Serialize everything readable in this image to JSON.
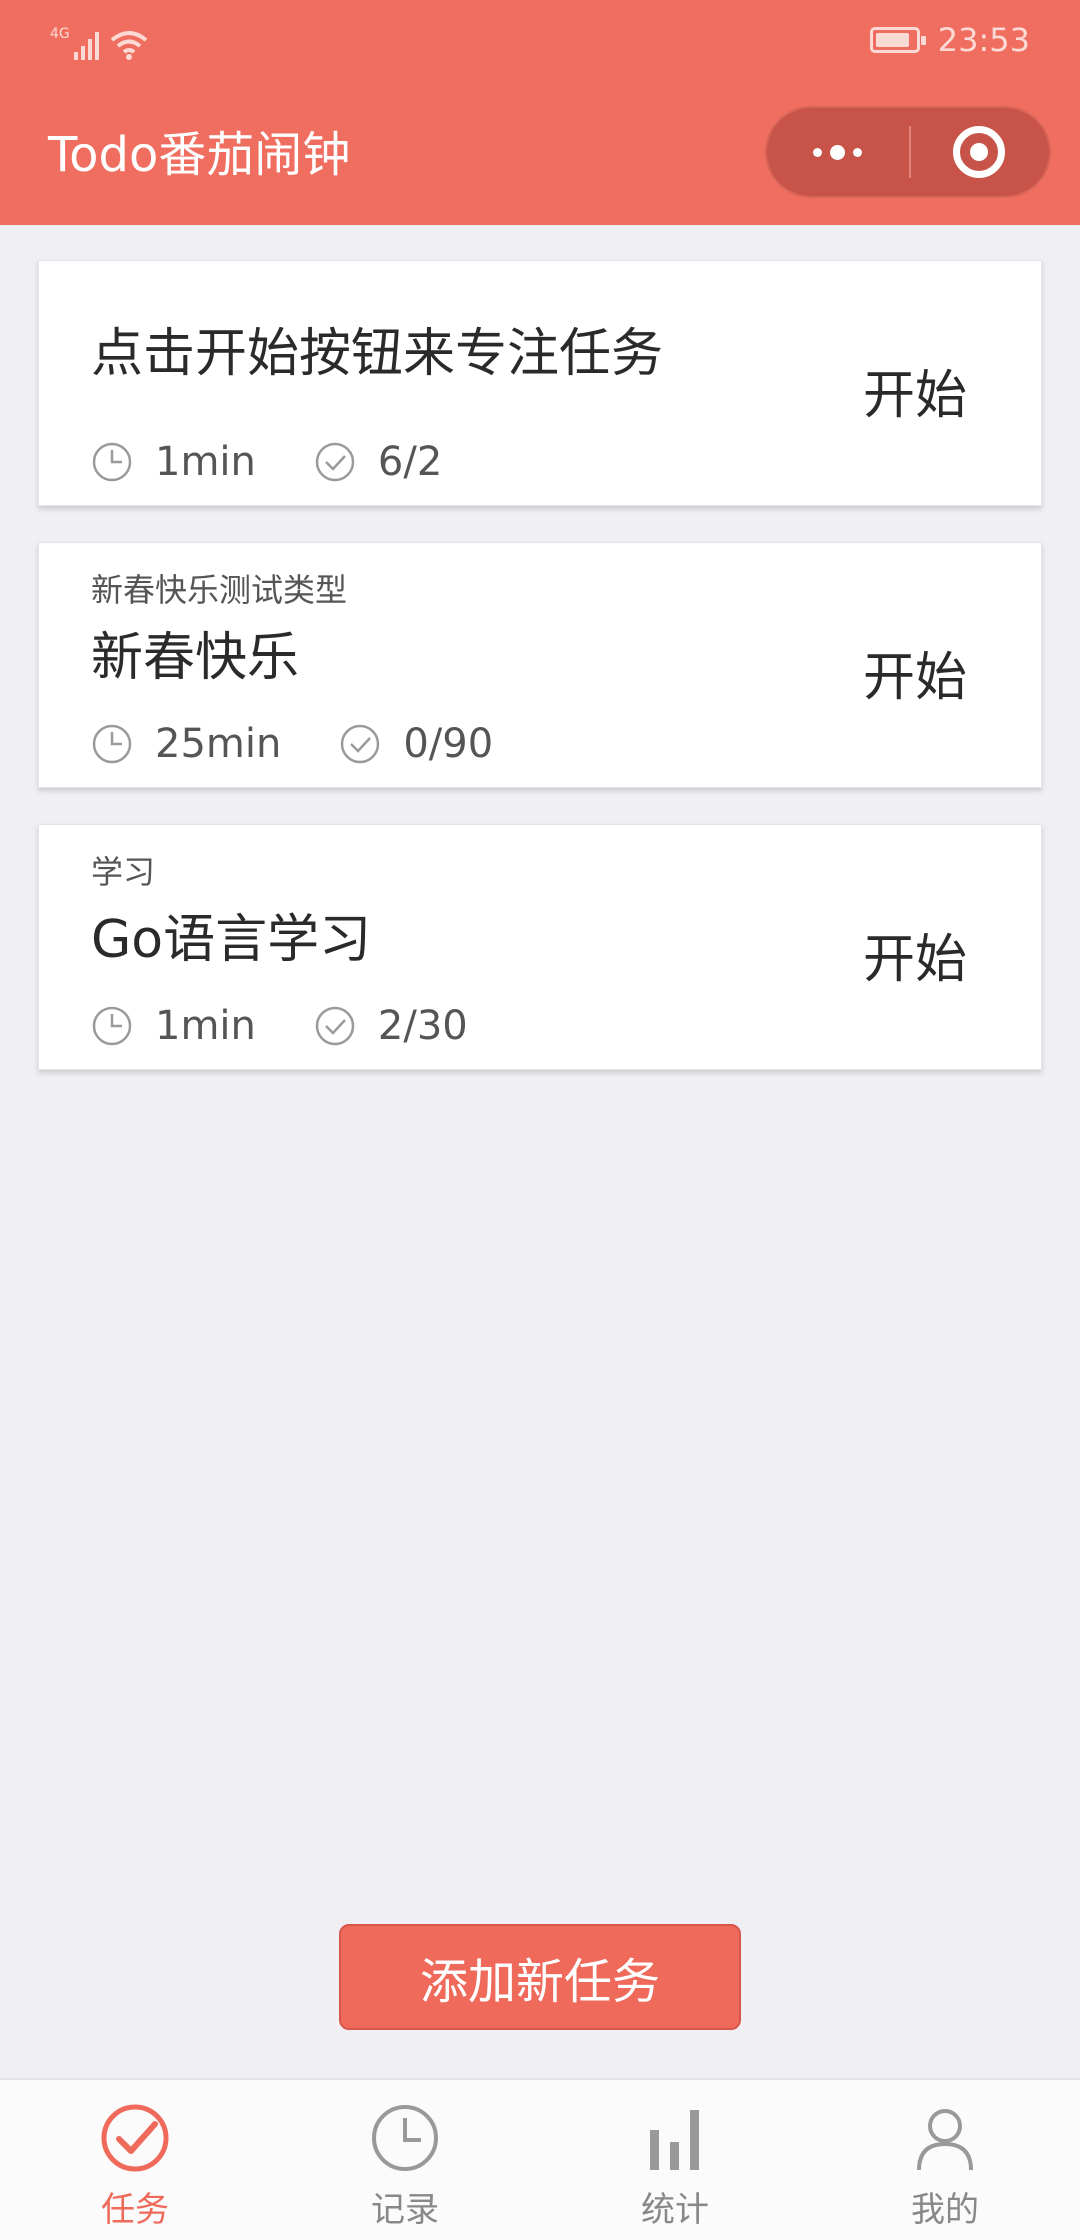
{
  "status_bar": {
    "network": "4G",
    "time": "23:53"
  },
  "header": {
    "title": "Todo番茄闹钟"
  },
  "tasks": [
    {
      "category": "",
      "name": "点击开始按钮来专注任务",
      "duration": "1min",
      "progress": "6/2",
      "action": "开始"
    },
    {
      "category": "新春快乐测试类型",
      "name": "新春快乐",
      "duration": "25min",
      "progress": "0/90",
      "action": "开始"
    },
    {
      "category": "学习",
      "name": "Go语言学习",
      "duration": "1min",
      "progress": "2/30",
      "action": "开始"
    }
  ],
  "add_button": {
    "label": "添加新任务"
  },
  "tabbar": {
    "items": [
      {
        "label": "任务",
        "icon": "check-circle-icon",
        "active": true
      },
      {
        "label": "记录",
        "icon": "clock-icon",
        "active": false
      },
      {
        "label": "统计",
        "icon": "bar-chart-icon",
        "active": false
      },
      {
        "label": "我的",
        "icon": "user-icon",
        "active": false
      }
    ]
  },
  "colors": {
    "accent": "#f06e60",
    "background": "#efeff4"
  }
}
